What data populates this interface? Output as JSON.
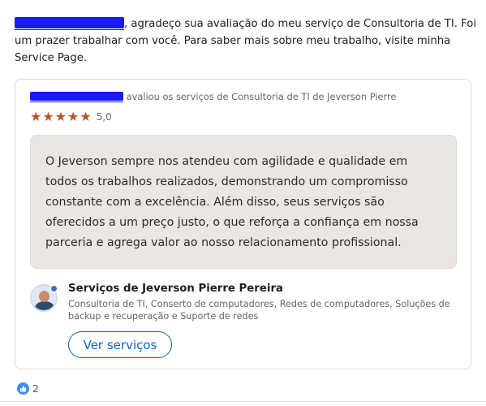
{
  "intro": {
    "text": ", agradeço sua avaliação do meu serviço de Consultoria de TI. Foi um prazer trabalhar com você. Para saber mais sobre meu trabalho, visite minha Service Page."
  },
  "review": {
    "reviewer_text": " avaliou os serviços de Consultoria de TI de Jeverson Pierre",
    "stars": 5,
    "rating_label": "5,0",
    "quote": "O Jeverson sempre nos atendeu com agilidade e qualidade em todos os trabalhos realizados, demonstrando um compromisso constante com a excelência. Além disso, seus serviços são oferecidos a um preço justo, o que reforça a confiança em nossa parceria e agrega valor ao nosso relacionamento profissional."
  },
  "service": {
    "title": "Serviços de Jeverson Pierre Pereira",
    "description": "Consultoria de TI, Conserto de computadores, Redes de computadores, Soluções de backup e recuperação e Suporte de redes",
    "button_label": "Ver serviços"
  },
  "reactions": {
    "count": "2",
    "icon": "like-icon"
  },
  "colors": {
    "star": "#b6562a",
    "accent": "#0a66c2",
    "quote_bg": "#ebe6e2",
    "redaction": "#1a1af5"
  }
}
